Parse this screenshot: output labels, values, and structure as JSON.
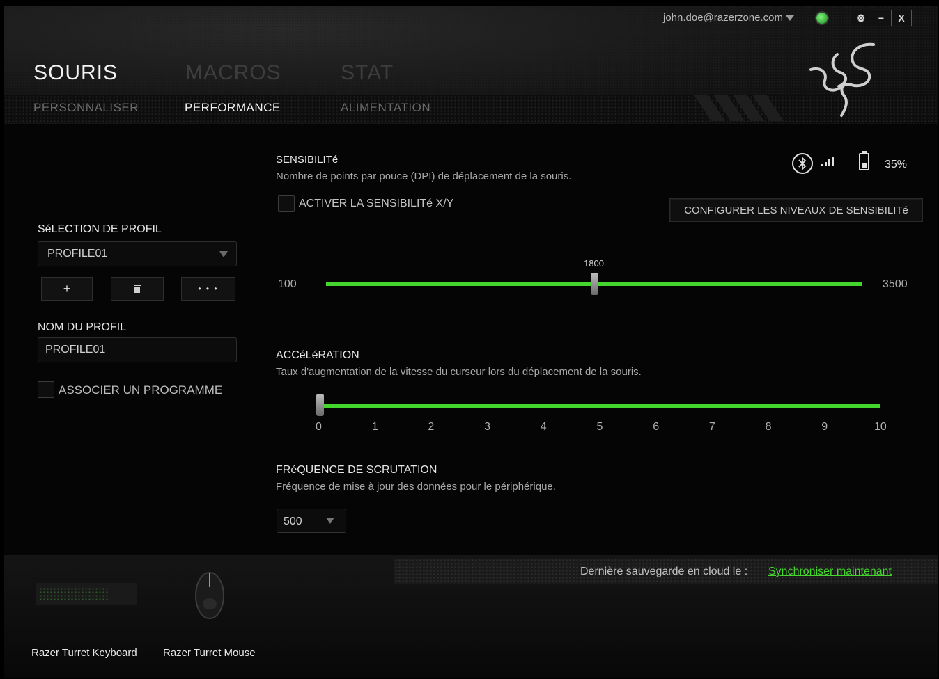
{
  "window": {
    "user_email": "john.doe@razerzone.com",
    "buttons": {
      "settings": "⚙",
      "minimize": "−",
      "close": "X"
    }
  },
  "tabs": [
    {
      "label": "SOURIS",
      "active": true
    },
    {
      "label": "MACROS",
      "active": false
    },
    {
      "label": "STAT",
      "active": false
    }
  ],
  "subtabs": [
    {
      "label": "PERSONNALISER",
      "active": false
    },
    {
      "label": "PERFORMANCE",
      "active": true
    },
    {
      "label": "ALIMENTATION",
      "active": false
    }
  ],
  "profile": {
    "selection_label": "SéLECTION DE PROFIL",
    "selected": "PROFILE01",
    "buttons": {
      "add": "+",
      "delete": "🗑",
      "more": "• • •"
    },
    "name_label": "NOM DU PROFIL",
    "name_value": "PROFILE01",
    "link_program_label": "ASSOCIER UN PROGRAMME"
  },
  "status": {
    "battery_percent": "35%",
    "battery_level": 0.35,
    "connection": "bluetooth",
    "signal": "signal-bars"
  },
  "sensitivity": {
    "title": "SENSIBILITé",
    "description": "Nombre de points par pouce (DPI) de déplacement de la souris.",
    "xy_checkbox_label": "ACTIVER LA SENSIBILITé X/Y",
    "configure_button": "CONFIGURER LES NIVEAUX DE SENSIBILITé",
    "min_label": "100",
    "max_label": "3500",
    "value_label": "1800",
    "min": 100,
    "max": 3500,
    "value": 1800
  },
  "acceleration": {
    "title": "ACCéLéRATION",
    "description": "Taux d'augmentation de la vitesse du curseur lors du déplacement de la souris.",
    "ticks": [
      "0",
      "1",
      "2",
      "3",
      "4",
      "5",
      "6",
      "7",
      "8",
      "9",
      "10"
    ],
    "value": 0,
    "min": 0,
    "max": 10
  },
  "polling": {
    "title": "FRéQUENCE DE SCRUTATION",
    "description": "Fréquence de mise à jour des données pour le périphérique.",
    "selected": "500"
  },
  "footer": {
    "cloud_label": "Dernière sauvegarde en cloud le :",
    "sync_link": "Synchroniser maintenant",
    "devices": [
      "Razer Turret Keyboard",
      "Razer Turret Mouse"
    ]
  },
  "colors": {
    "accent": "#44d62c"
  }
}
